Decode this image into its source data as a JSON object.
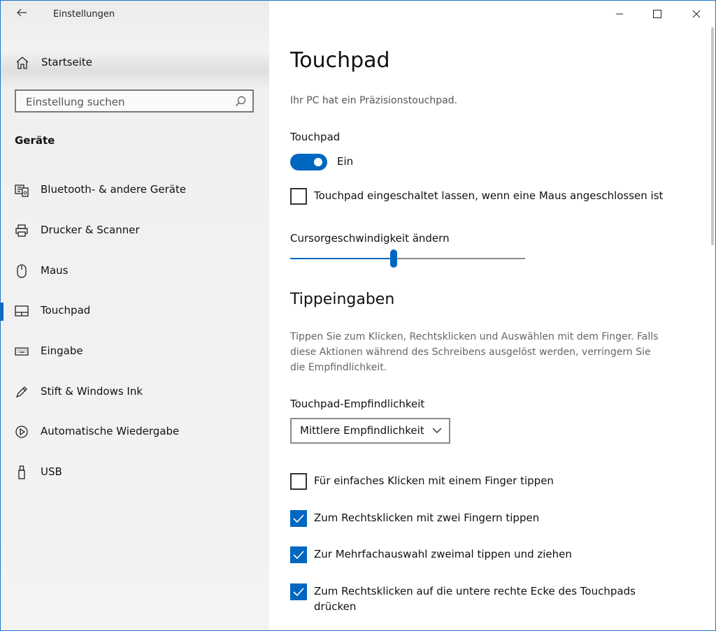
{
  "window": {
    "app_title": "Einstellungen",
    "controls": [
      "minimize-icon",
      "maximize-icon",
      "close-icon"
    ]
  },
  "sidebar": {
    "home_label": "Startseite",
    "search_placeholder": "Einstellung suchen",
    "section_title": "Geräte",
    "items": [
      {
        "label": "Bluetooth- & andere Geräte",
        "icon": "bluetooth-devices-icon"
      },
      {
        "label": "Drucker & Scanner",
        "icon": "printer-icon"
      },
      {
        "label": "Maus",
        "icon": "mouse-icon"
      },
      {
        "label": "Touchpad",
        "icon": "touchpad-icon",
        "active": true
      },
      {
        "label": "Eingabe",
        "icon": "keyboard-icon"
      },
      {
        "label": "Stift & Windows Ink",
        "icon": "pen-icon"
      },
      {
        "label": "Automatische Wiedergabe",
        "icon": "autoplay-icon"
      },
      {
        "label": "USB",
        "icon": "usb-icon"
      }
    ]
  },
  "main": {
    "title": "Touchpad",
    "subtitle": "Ihr PC hat ein Präzisionstouchpad.",
    "touchpad_toggle": {
      "label": "Touchpad",
      "state_text": "Ein",
      "on": true
    },
    "keep_on_checkbox": {
      "label": "Touchpad eingeschaltet lassen, wenn eine Maus angeschlossen ist",
      "checked": false
    },
    "cursor_speed": {
      "label": "Cursorgeschwindigkeit ändern",
      "value_fraction": 0.44
    },
    "taps": {
      "heading": "Tippeingaben",
      "description": "Tippen Sie zum Klicken, Rechtsklicken und Auswählen mit dem Finger. Falls diese Aktionen während des Schreibens ausgelöst werden, verringern Sie die Empfindlichkeit.",
      "sensitivity_label": "Touchpad-Empfindlichkeit",
      "sensitivity_value": "Mittlere Empfindlichkeit",
      "options": [
        {
          "label": "Für einfaches Klicken mit einem Finger tippen",
          "checked": false
        },
        {
          "label": "Zum Rechtsklicken mit zwei Fingern tippen",
          "checked": true
        },
        {
          "label": "Zur Mehrfachauswahl zweimal tippen und ziehen",
          "checked": true
        },
        {
          "label": "Zum Rechtsklicken auf die untere rechte Ecke des Touchpads drücken",
          "checked": true
        }
      ]
    }
  },
  "colors": {
    "accent": "#0067c0",
    "sidebar_bg": "#f2f2f2"
  }
}
